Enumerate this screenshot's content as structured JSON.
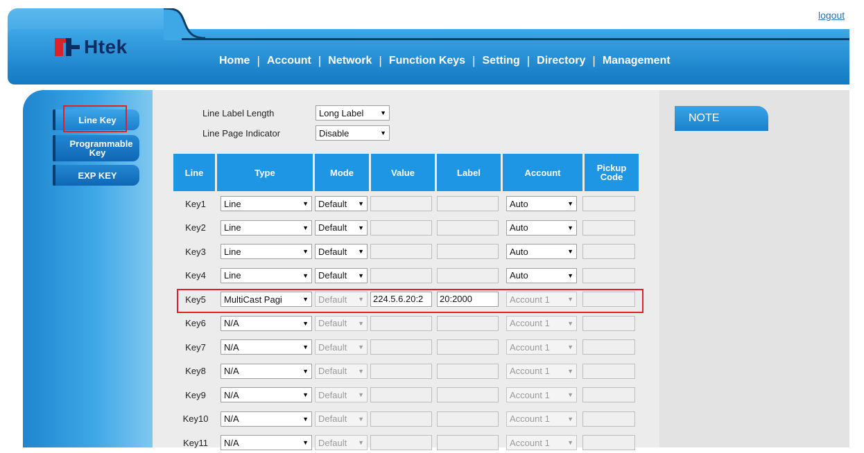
{
  "header": {
    "logout": "logout",
    "logo_text": "Htek",
    "nav": [
      "Home",
      "Account",
      "Network",
      "Function Keys",
      "Setting",
      "Directory",
      "Management"
    ]
  },
  "sidebar": {
    "items": [
      "Line Key",
      "Programmable Key",
      "EXP KEY"
    ],
    "active": "Line Key"
  },
  "options": {
    "line_label_length": {
      "label": "Line Label Length",
      "value": "Long Label"
    },
    "line_page_indicator": {
      "label": "Line Page Indicator",
      "value": "Disable"
    }
  },
  "table": {
    "headers": [
      "Line",
      "Type",
      "Mode",
      "Value",
      "Label",
      "Account",
      "Pickup Code"
    ],
    "rows": [
      {
        "key": "Key1",
        "type": "Line",
        "mode": "Default",
        "value": "",
        "label": "",
        "account": "Auto",
        "pickup": "",
        "enabled": true
      },
      {
        "key": "Key2",
        "type": "Line",
        "mode": "Default",
        "value": "",
        "label": "",
        "account": "Auto",
        "pickup": "",
        "enabled": true
      },
      {
        "key": "Key3",
        "type": "Line",
        "mode": "Default",
        "value": "",
        "label": "",
        "account": "Auto",
        "pickup": "",
        "enabled": true
      },
      {
        "key": "Key4",
        "type": "Line",
        "mode": "Default",
        "value": "",
        "label": "",
        "account": "Auto",
        "pickup": "",
        "enabled": true
      },
      {
        "key": "Key5",
        "type": "MultiCast Pagi",
        "mode": "Default",
        "value": "224.5.6.20:2",
        "label": "20:2000",
        "account": "Account 1",
        "pickup": "",
        "enabled": false,
        "highlighted": true
      },
      {
        "key": "Key6",
        "type": "N/A",
        "mode": "Default",
        "value": "",
        "label": "",
        "account": "Account 1",
        "pickup": "",
        "enabled": false
      },
      {
        "key": "Key7",
        "type": "N/A",
        "mode": "Default",
        "value": "",
        "label": "",
        "account": "Account 1",
        "pickup": "",
        "enabled": false
      },
      {
        "key": "Key8",
        "type": "N/A",
        "mode": "Default",
        "value": "",
        "label": "",
        "account": "Account 1",
        "pickup": "",
        "enabled": false
      },
      {
        "key": "Key9",
        "type": "N/A",
        "mode": "Default",
        "value": "",
        "label": "",
        "account": "Account 1",
        "pickup": "",
        "enabled": false
      },
      {
        "key": "Key10",
        "type": "N/A",
        "mode": "Default",
        "value": "",
        "label": "",
        "account": "Account 1",
        "pickup": "",
        "enabled": false
      },
      {
        "key": "Key11",
        "type": "N/A",
        "mode": "Default",
        "value": "",
        "label": "",
        "account": "Account 1",
        "pickup": "",
        "enabled": false
      }
    ]
  },
  "note": {
    "title": "NOTE"
  },
  "colors": {
    "brand_blue": "#1e96e4",
    "highlight_red": "#e02025",
    "logo_navy": "#0c2d64",
    "logo_red": "#d8232a"
  }
}
